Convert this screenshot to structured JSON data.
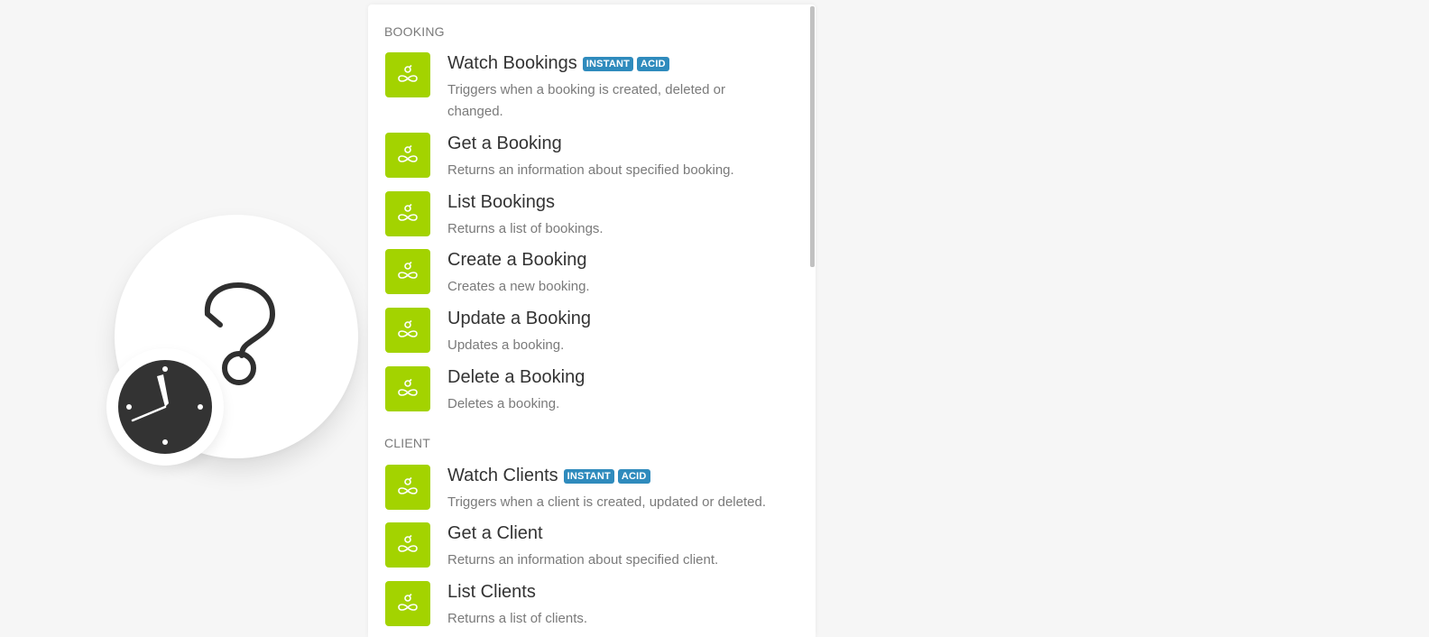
{
  "colors": {
    "app_tile": "#a3d300",
    "badge": "#2f8bbd",
    "background": "#f6f6f6"
  },
  "module": {
    "icons": [
      "question-mark-icon",
      "clock-icon"
    ]
  },
  "sections": [
    {
      "header": "BOOKING",
      "items": [
        {
          "title": "Watch Bookings",
          "badges": [
            "INSTANT",
            "ACID"
          ],
          "description": "Triggers when a booking is created, deleted or changed."
        },
        {
          "title": "Get a Booking",
          "badges": [],
          "description": "Returns an information about specified booking."
        },
        {
          "title": "List Bookings",
          "badges": [],
          "description": "Returns a list of bookings."
        },
        {
          "title": "Create a Booking",
          "badges": [],
          "description": "Creates a new booking."
        },
        {
          "title": "Update a Booking",
          "badges": [],
          "description": "Updates a booking."
        },
        {
          "title": "Delete a Booking",
          "badges": [],
          "description": "Deletes a booking."
        }
      ]
    },
    {
      "header": "CLIENT",
      "items": [
        {
          "title": "Watch Clients",
          "badges": [
            "INSTANT",
            "ACID"
          ],
          "description": "Triggers when a client is created, updated or deleted."
        },
        {
          "title": "Get a Client",
          "badges": [],
          "description": "Returns an information about specified client."
        },
        {
          "title": "List Clients",
          "badges": [],
          "description": "Returns a list of clients."
        }
      ]
    }
  ]
}
